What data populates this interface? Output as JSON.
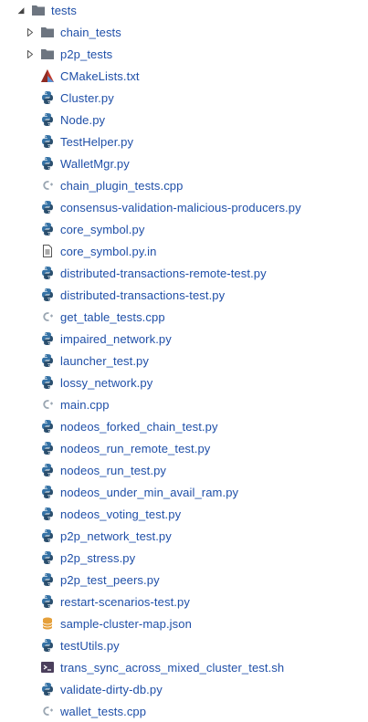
{
  "explorer": {
    "root": {
      "label": "tests",
      "expanded": true,
      "icon": "folder-icon"
    },
    "folders": [
      {
        "label": "chain_tests",
        "expanded": false,
        "icon": "folder-icon"
      },
      {
        "label": "p2p_tests",
        "expanded": false,
        "icon": "folder-icon"
      }
    ],
    "files": [
      {
        "label": "CMakeLists.txt",
        "icon": "cmake-icon"
      },
      {
        "label": "Cluster.py",
        "icon": "python-icon"
      },
      {
        "label": "Node.py",
        "icon": "python-icon"
      },
      {
        "label": "TestHelper.py",
        "icon": "python-icon"
      },
      {
        "label": "WalletMgr.py",
        "icon": "python-icon"
      },
      {
        "label": "chain_plugin_tests.cpp",
        "icon": "cpp-icon"
      },
      {
        "label": "consensus-validation-malicious-producers.py",
        "icon": "python-icon"
      },
      {
        "label": "core_symbol.py",
        "icon": "python-icon"
      },
      {
        "label": "core_symbol.py.in",
        "icon": "text-file-icon"
      },
      {
        "label": "distributed-transactions-remote-test.py",
        "icon": "python-icon"
      },
      {
        "label": "distributed-transactions-test.py",
        "icon": "python-icon"
      },
      {
        "label": "get_table_tests.cpp",
        "icon": "cpp-icon"
      },
      {
        "label": "impaired_network.py",
        "icon": "python-icon"
      },
      {
        "label": "launcher_test.py",
        "icon": "python-icon"
      },
      {
        "label": "lossy_network.py",
        "icon": "python-icon"
      },
      {
        "label": "main.cpp",
        "icon": "cpp-icon"
      },
      {
        "label": "nodeos_forked_chain_test.py",
        "icon": "python-icon"
      },
      {
        "label": "nodeos_run_remote_test.py",
        "icon": "python-icon"
      },
      {
        "label": "nodeos_run_test.py",
        "icon": "python-icon"
      },
      {
        "label": "nodeos_under_min_avail_ram.py",
        "icon": "python-icon"
      },
      {
        "label": "nodeos_voting_test.py",
        "icon": "python-icon"
      },
      {
        "label": "p2p_network_test.py",
        "icon": "python-icon"
      },
      {
        "label": "p2p_stress.py",
        "icon": "python-icon"
      },
      {
        "label": "p2p_test_peers.py",
        "icon": "python-icon"
      },
      {
        "label": "restart-scenarios-test.py",
        "icon": "python-icon"
      },
      {
        "label": "sample-cluster-map.json",
        "icon": "json-icon"
      },
      {
        "label": "testUtils.py",
        "icon": "python-icon"
      },
      {
        "label": "trans_sync_across_mixed_cluster_test.sh",
        "icon": "shell-icon"
      },
      {
        "label": "validate-dirty-db.py",
        "icon": "python-icon"
      },
      {
        "label": "wallet_tests.cpp",
        "icon": "cpp-icon"
      }
    ],
    "colors": {
      "label": "#1f4fa8",
      "folder": "#6d7580",
      "python_blue": "#3572a5",
      "python_dark": "#2b4f6e",
      "cmake_red": "#c0392b",
      "cpp_gray": "#9aa6b2",
      "json_orange": "#e5a03a",
      "shell_purple": "#4b3f5c"
    }
  }
}
